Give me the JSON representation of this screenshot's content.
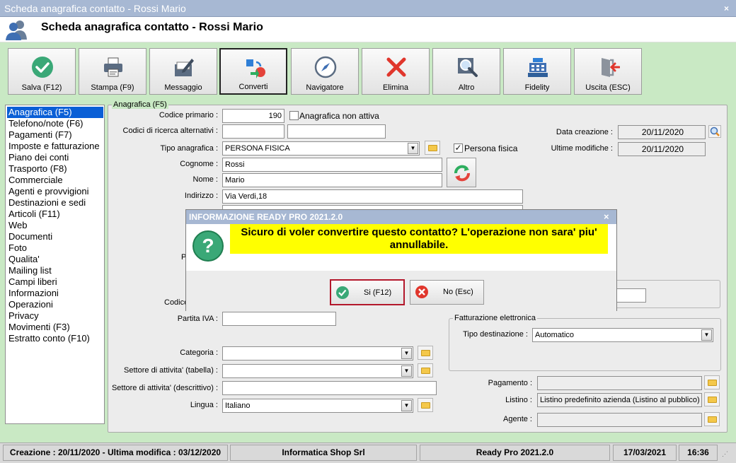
{
  "window": {
    "title": "Scheda anagrafica contatto - Rossi Mario",
    "close": "×"
  },
  "header": {
    "title": "Scheda anagrafica contatto - Rossi Mario"
  },
  "toolbar": {
    "buttons": [
      {
        "label": "Salva (F12)",
        "icon": "check-icon"
      },
      {
        "label": "Stampa (F9)",
        "icon": "printer-icon"
      },
      {
        "label": "Messaggio",
        "icon": "message-icon"
      },
      {
        "label": "Converti",
        "icon": "convert-icon"
      },
      {
        "label": "Navigatore",
        "icon": "compass-icon"
      },
      {
        "label": "Elimina",
        "icon": "delete-x-icon"
      },
      {
        "label": "Altro",
        "icon": "magnifier-icon"
      },
      {
        "label": "Fidelity",
        "icon": "cash-register-icon"
      },
      {
        "label": "Uscita (ESC)",
        "icon": "exit-door-icon"
      }
    ]
  },
  "sidebar": {
    "items": [
      {
        "label": "Anagrafica (F5)"
      },
      {
        "label": "Telefono/note (F6)"
      },
      {
        "label": "Pagamenti (F7)"
      },
      {
        "label": "Imposte e fatturazione"
      },
      {
        "label": "Piano dei conti"
      },
      {
        "label": "Trasporto (F8)"
      },
      {
        "label": "Commerciale"
      },
      {
        "label": "Agenti e provvigioni"
      },
      {
        "label": "Destinazioni e sedi"
      },
      {
        "label": "Articoli (F11)"
      },
      {
        "label": "Web"
      },
      {
        "label": "Documenti"
      },
      {
        "label": "Foto"
      },
      {
        "label": "Qualita'"
      },
      {
        "label": "Mailing list"
      },
      {
        "label": "Campi liberi"
      },
      {
        "label": "Informazioni"
      },
      {
        "label": "Operazioni"
      },
      {
        "label": "Privacy"
      },
      {
        "label": "Movimenti (F3)"
      },
      {
        "label": "Estratto conto (F10)"
      }
    ]
  },
  "form": {
    "group_title": "Anagrafica (F5)",
    "codice_primario_label": "Codice primario :",
    "codice_primario_value": "190",
    "non_attiva_label": "Anagrafica non attiva",
    "codici_ricerca_label": "Codici di ricerca alternativi :",
    "tipo_anagrafica_label": "Tipo anagrafica :",
    "tipo_anagrafica_value": "PERSONA FISICA",
    "persona_fisica_label": "Persona fisica",
    "cognome_label": "Cognome :",
    "cognome_value": "Rossi",
    "nome_label": "Nome :",
    "nome_value": "Mario",
    "indirizzo_label": "Indirizzo :",
    "indirizzo_value": "Via Verdi,18",
    "data_creazione_label": "Data creazione :",
    "data_creazione_value": "20/11/2020",
    "ultime_modifiche_label": "Ultime modifiche :",
    "ultime_modifiche_value": "20/11/2020",
    "partial_p": "P",
    "partial_codice": "Codice",
    "partita_iva_label": "Partita IVA :",
    "fatt_elettronica_title": "Fatturazione elettronica",
    "tipo_destinazione_label": "Tipo destinazione :",
    "tipo_destinazione_value": "Automatico",
    "categoria_label": "Categoria :",
    "settore_tabella_label": "Settore di attivita' (tabella) :",
    "settore_descr_label": "Settore di attivita' (descrittivo) :",
    "lingua_label": "Lingua :",
    "lingua_value": "Italiano",
    "pagamento_label": "Pagamento :",
    "listino_label": "Listino :",
    "listino_value": "Listino predefinito azienda (Listino al pubblico)",
    "agente_label": "Agente :",
    "check_mark": "✓"
  },
  "dialog": {
    "title": "INFORMAZIONE READY PRO 2021.2.0",
    "close": "×",
    "message": "Sicuro di voler convertire questo contatto? L'operazione non sara' piu' annullabile.",
    "yes_label": "Si (F12)",
    "no_label": "No (Esc)",
    "icon_text": "?"
  },
  "status": {
    "creazione": "Creazione : 20/11/2020 - Ultima modifica : 03/12/2020",
    "company": "Informatica Shop Srl",
    "app": "Ready Pro 2021.2.0",
    "date": "17/03/2021",
    "time": "16:36"
  },
  "colors": {
    "accent_selection": "#0a5fd6",
    "dialog_highlight": "#ffff00",
    "background": "#c9e9c4"
  }
}
